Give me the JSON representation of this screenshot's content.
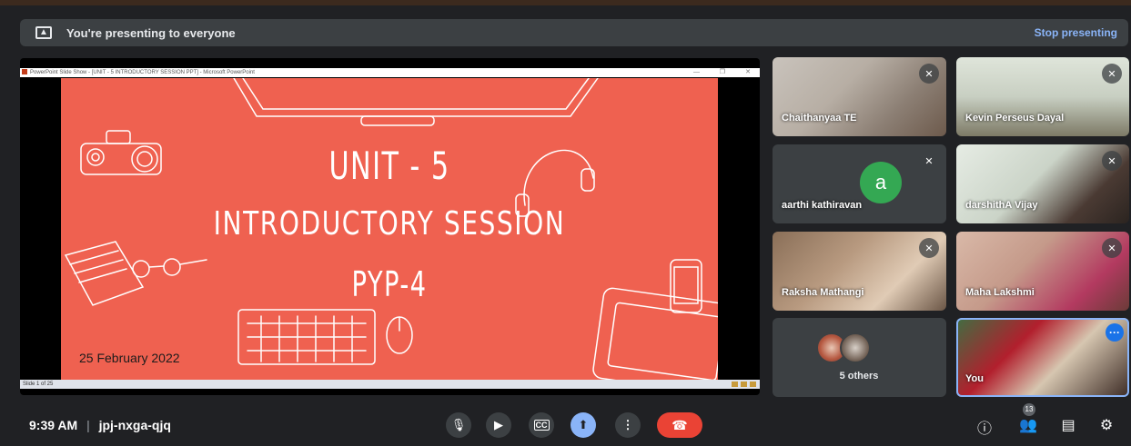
{
  "banner": {
    "message": "You're presenting to everyone",
    "stop_label": "Stop presenting"
  },
  "presentation": {
    "window_title": "PowerPoint Slide Show - [UNIT - 5 INTRODUCTORY SESSION PPT] - Microsoft PowerPoint",
    "slide": {
      "line1": "UNIT - 5",
      "line2": "INTRODUCTORY SESSION",
      "line3": "PYP-4",
      "date": "25 February 2022",
      "background_color": "#ef6150"
    },
    "status": "Slide 1 of 25"
  },
  "participants": [
    {
      "name": "Chaithanyaa TE",
      "muted": true
    },
    {
      "name": "Kevin Perseus Dayal",
      "muted": true
    },
    {
      "name": "aarthi kathiravan",
      "muted": true,
      "avatar_letter": "a",
      "avatar_color": "#34a853"
    },
    {
      "name": "darshithA Vijay",
      "muted": true
    },
    {
      "name": "Raksha Mathangi",
      "muted": true
    },
    {
      "name": "Maha Lakshmi",
      "muted": true
    },
    {
      "name": "5 others"
    },
    {
      "name": "You"
    }
  ],
  "footer": {
    "time": "9:39 AM",
    "separator": "|",
    "meeting_code": "jpj-nxga-qjq",
    "controls": [
      "mic-icon",
      "camera-icon",
      "captions-icon",
      "present-icon",
      "more-options-icon",
      "end-call-icon"
    ],
    "right_icons": [
      "info-icon",
      "people-icon",
      "chat-icon",
      "activities-icon"
    ],
    "participant_count": "13"
  },
  "colors": {
    "background": "#202124",
    "accent_blue": "#8ab4f8",
    "end_call_red": "#ea4335"
  }
}
